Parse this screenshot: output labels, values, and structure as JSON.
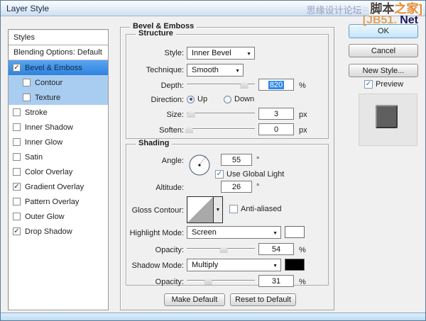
{
  "window": {
    "title": "Layer Style"
  },
  "watermark": {
    "forum": "思缘设计论坛",
    "sep": "∷",
    "site_dark": "脚本",
    "site_orange": "之家",
    "bracket_close": "]",
    "bracket_open": "[",
    "jb": "JB51.",
    "net": " Net"
  },
  "styles_panel": {
    "header": "Styles",
    "blending": "Blending Options: Default",
    "items": [
      {
        "label": "Bevel & Emboss",
        "checked": true,
        "state": "selected"
      },
      {
        "label": "Contour",
        "checked": false,
        "state": "sub-selected"
      },
      {
        "label": "Texture",
        "checked": false,
        "state": "sub-selected"
      },
      {
        "label": "Stroke",
        "checked": false,
        "state": "normal"
      },
      {
        "label": "Inner Shadow",
        "checked": false,
        "state": "normal"
      },
      {
        "label": "Inner Glow",
        "checked": false,
        "state": "normal"
      },
      {
        "label": "Satin",
        "checked": false,
        "state": "normal"
      },
      {
        "label": "Color Overlay",
        "checked": false,
        "state": "normal"
      },
      {
        "label": "Gradient Overlay",
        "checked": true,
        "state": "normal"
      },
      {
        "label": "Pattern Overlay",
        "checked": false,
        "state": "normal"
      },
      {
        "label": "Outer Glow",
        "checked": false,
        "state": "normal"
      },
      {
        "label": "Drop Shadow",
        "checked": true,
        "state": "normal"
      }
    ]
  },
  "main": {
    "group_title": "Bevel & Emboss",
    "structure": {
      "title": "Structure",
      "style_label": "Style:",
      "style_value": "Inner Bevel",
      "technique_label": "Technique:",
      "technique_value": "Smooth",
      "depth_label": "Depth:",
      "depth_value": "820",
      "depth_unit": "%",
      "depth_slider_pct": 84,
      "direction_label": "Direction:",
      "up_label": "Up",
      "down_label": "Down",
      "direction_selected": "Up",
      "size_label": "Size:",
      "size_value": "3",
      "size_unit": "px",
      "size_slider_pct": 6,
      "soften_label": "Soften:",
      "soften_value": "0",
      "soften_unit": "px",
      "soften_slider_pct": 3
    },
    "shading": {
      "title": "Shading",
      "angle_label": "Angle:",
      "angle_value": "55",
      "angle_unit": "°",
      "use_global_light": "Use Global Light",
      "use_global_light_checked": true,
      "altitude_label": "Altitude:",
      "altitude_value": "26",
      "altitude_unit": "°",
      "gloss_label": "Gloss Contour:",
      "antialiased_label": "Anti-aliased",
      "antialiased_checked": false,
      "highlight_mode_label": "Highlight Mode:",
      "highlight_mode_value": "Screen",
      "highlight_swatch": "#ffffff",
      "highlight_opacity_label": "Opacity:",
      "highlight_opacity_value": "54",
      "highlight_opacity_unit": "%",
      "highlight_opacity_pct": 54,
      "shadow_mode_label": "Shadow Mode:",
      "shadow_mode_value": "Multiply",
      "shadow_swatch": "#000000",
      "shadow_opacity_label": "Opacity:",
      "shadow_opacity_value": "31",
      "shadow_opacity_unit": "%",
      "shadow_opacity_pct": 31
    },
    "footer_buttons": {
      "make_default": "Make Default",
      "reset_default": "Reset to Default"
    }
  },
  "right_column": {
    "ok": "OK",
    "cancel": "Cancel",
    "new_style": "New Style...",
    "preview": "Preview",
    "preview_checked": true
  },
  "colors": {
    "selection_blue": "#2e8ae6",
    "selected_row": "#3f97ef",
    "sub_row": "#a9cdf1"
  }
}
